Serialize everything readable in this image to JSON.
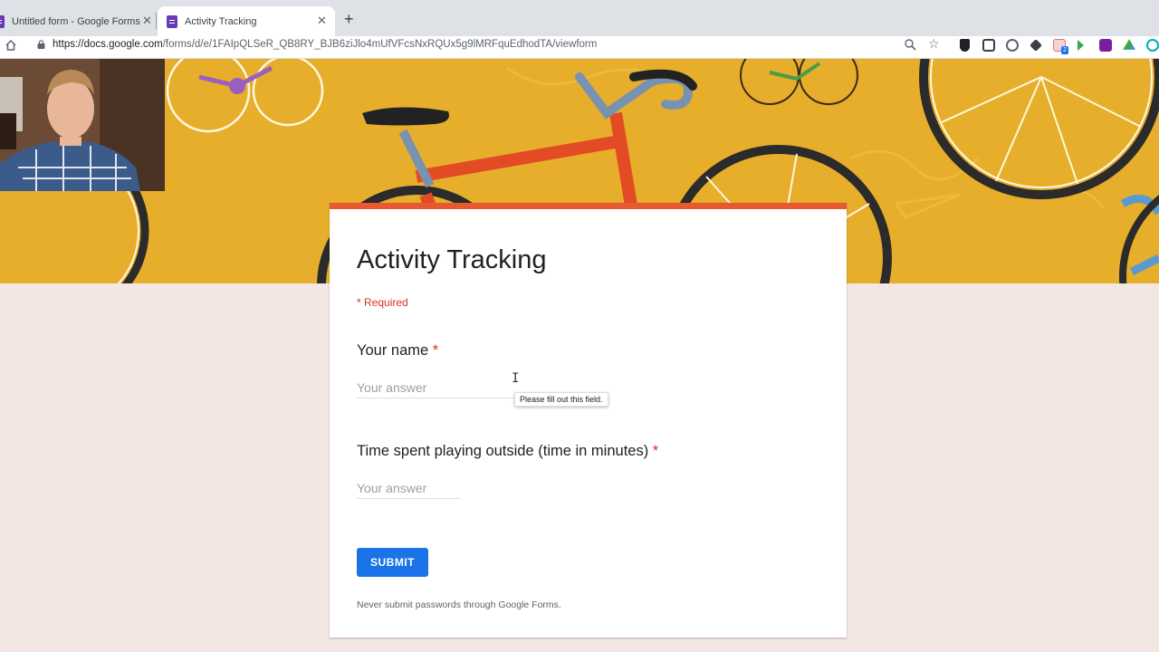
{
  "browser": {
    "tabs": [
      {
        "label": "Untitled form - Google Forms",
        "active": false
      },
      {
        "label": "Activity Tracking",
        "active": true
      }
    ],
    "url_host": "https://docs.google.com",
    "url_path": "/forms/d/e/1FAIpQLSeR_QB8RY_BJB6ziJlo4mUfVFcsNxRQUx5g9lMRFquEdhodTA/viewform",
    "extensions_badge": "2"
  },
  "colors": {
    "accent": "#e8592f",
    "required": "#d93025",
    "submit": "#1a73e8",
    "page_bg": "#f3e6e3",
    "banner": "#e6ae2a"
  },
  "form": {
    "title": "Activity Tracking",
    "required_note": "* Required",
    "questions": [
      {
        "label": "Your name",
        "required_mark": "*",
        "placeholder": "Your answer"
      },
      {
        "label": "Time spent playing outside (time in minutes)",
        "required_mark": "*",
        "placeholder": "Your answer"
      }
    ],
    "submit_label": "SUBMIT",
    "footer_note": "Never submit passwords through Google Forms."
  },
  "tooltip": "Please fill out this field."
}
